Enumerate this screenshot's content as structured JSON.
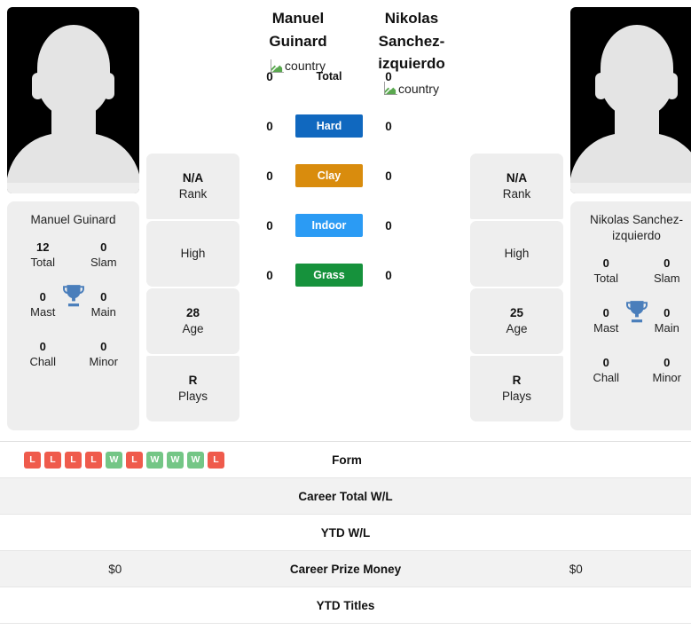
{
  "players": {
    "left": {
      "name": "Manuel Guinard",
      "header_name": "Manuel Guinard",
      "country_alt": "country",
      "titles": [
        {
          "value": "12",
          "label": "Total"
        },
        {
          "value": "0",
          "label": "Slam"
        },
        {
          "value": "0",
          "label": "Mast"
        },
        {
          "value": "0",
          "label": "Main"
        },
        {
          "value": "0",
          "label": "Chall"
        },
        {
          "value": "0",
          "label": "Minor"
        }
      ],
      "info": [
        {
          "value": "N/A",
          "label": "Rank"
        },
        {
          "value": "",
          "label": "High"
        },
        {
          "value": "28",
          "label": "Age"
        },
        {
          "value": "R",
          "label": "Plays"
        }
      ]
    },
    "right": {
      "name": "Nikolas Sanchez-izquierdo",
      "header_name": "Nikolas Sanchez-izquierdo",
      "country_alt": "country",
      "titles": [
        {
          "value": "0",
          "label": "Total"
        },
        {
          "value": "0",
          "label": "Slam"
        },
        {
          "value": "0",
          "label": "Mast"
        },
        {
          "value": "0",
          "label": "Main"
        },
        {
          "value": "0",
          "label": "Chall"
        },
        {
          "value": "0",
          "label": "Minor"
        }
      ],
      "info": [
        {
          "value": "N/A",
          "label": "Rank"
        },
        {
          "value": "",
          "label": "High"
        },
        {
          "value": "25",
          "label": "Age"
        },
        {
          "value": "R",
          "label": "Plays"
        }
      ]
    }
  },
  "head_to_head": [
    {
      "label": "Total",
      "left": "0",
      "right": "0",
      "badge": false,
      "color": ""
    },
    {
      "label": "Hard",
      "left": "0",
      "right": "0",
      "badge": true,
      "color": "#1068bf"
    },
    {
      "label": "Clay",
      "left": "0",
      "right": "0",
      "badge": true,
      "color": "#d98c0d"
    },
    {
      "label": "Indoor",
      "left": "0",
      "right": "0",
      "badge": true,
      "color": "#2b9bf4"
    },
    {
      "label": "Grass",
      "left": "0",
      "right": "0",
      "badge": true,
      "color": "#16923c"
    }
  ],
  "form": {
    "label": "Form",
    "left_results": [
      "L",
      "L",
      "L",
      "L",
      "W",
      "L",
      "W",
      "W",
      "W",
      "L"
    ],
    "right_results": [],
    "win_color": "#74c686",
    "loss_color": "#ef5b4c"
  },
  "stats_rows": [
    {
      "label": "Career Total W/L",
      "left": "",
      "right": "",
      "striped": true
    },
    {
      "label": "YTD W/L",
      "left": "",
      "right": "",
      "striped": false
    },
    {
      "label": "Career Prize Money",
      "left": "$0",
      "right": "$0",
      "striped": true
    },
    {
      "label": "YTD Titles",
      "left": "",
      "right": "",
      "striped": false
    }
  ],
  "colors": {
    "trophy": "#4a7ebb",
    "card_bg": "#eeeeee",
    "stripe": "#f2f2f2"
  }
}
